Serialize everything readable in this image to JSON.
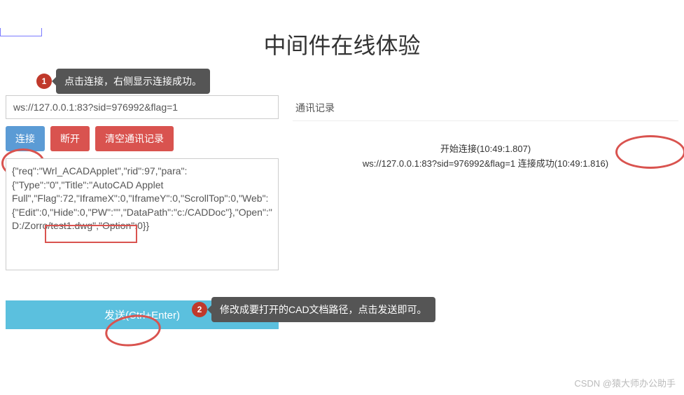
{
  "page": {
    "title": "中间件在线体验"
  },
  "tooltips": {
    "t1_badge": "1",
    "t1_text": "点击连接，右侧显示连接成功。",
    "t2_badge": "2",
    "t2_text": "修改成要打开的CAD文档路径，点击发送即可。"
  },
  "left": {
    "url_value": "ws://127.0.0.1:83?sid=976992&flag=1",
    "connect_label": "连接",
    "disconnect_label": "断开",
    "clear_label": "清空通讯记录",
    "payload_value": "{\"req\":\"Wrl_ACADApplet\",\"rid\":97,\"para\":{\"Type\":\"0\",\"Title\":\"AutoCAD Applet Full\",\"Flag\":72,\"IframeX\":0,\"IframeY\":0,\"ScrollTop\":0,\"Web\":{\"Edit\":0,\"Hide\":0,\"PW\":\"\",\"DataPath\":\"c:/CADDoc\"},\"Open\":\"D:/Zorro/test1.dwg\",\"Option\":0}}",
    "send_label": "发送(Ctrl+Enter)"
  },
  "right": {
    "log_header": "通讯记录",
    "log_line1": "开始连接(10:49:1.807)",
    "log_line2": "ws://127.0.0.1:83?sid=976992&flag=1 连接成功(10:49:1.816)"
  },
  "watermark": "CSDN @猿大师办公助手"
}
